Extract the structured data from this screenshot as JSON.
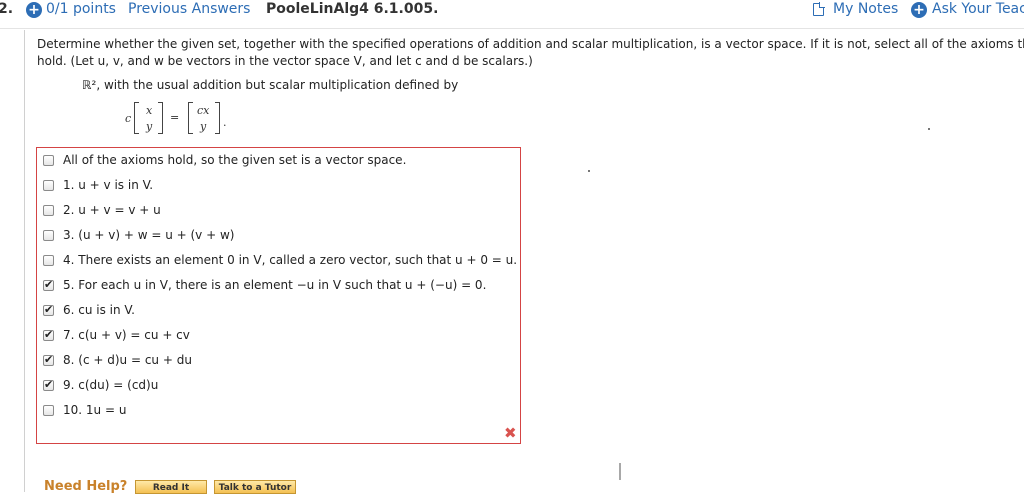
{
  "header": {
    "question_number": "2.",
    "points": "0/1 points",
    "previous_answers": "Previous Answers",
    "identifier": "PooleLinAlg4 6.1.005.",
    "my_notes": "My Notes",
    "ask_teacher": "Ask Your Teac"
  },
  "question": {
    "prompt_line1": "Determine whether the given set, together with the specified operations of addition and scalar multiplication, is a vector space. If it is not, select all of the axioms that fai",
    "prompt_line2": "hold. (Let u, v, and w be vectors in the vector space V, and let c and d be scalars.)",
    "set_description": "ℝ², with the usual addition but scalar multiplication defined by",
    "formula": {
      "scalar": "c",
      "left_top": "x",
      "left_bottom": "y",
      "equals": "=",
      "right_top": "cx",
      "right_bottom": "y",
      "end": "."
    }
  },
  "options": [
    {
      "text": "All of the axioms hold, so the given set is a vector space.",
      "checked": false
    },
    {
      "text": "1. u + v is in V.",
      "checked": false
    },
    {
      "text": "2. u + v = v + u",
      "checked": false
    },
    {
      "text": "3. (u + v) + w = u + (v + w)",
      "checked": false
    },
    {
      "text": "4. There exists an element 0 in V, called a zero vector, such that u + 0 = u.",
      "checked": false
    },
    {
      "text": "5. For each u in V, there is an element −u in V such that u + (−u) = 0.",
      "checked": true
    },
    {
      "text": "6. cu is in V.",
      "checked": true
    },
    {
      "text": "7. c(u + v) = cu + cv",
      "checked": true
    },
    {
      "text": "8. (c + d)u = cu + du",
      "checked": true
    },
    {
      "text": "9. c(du) = (cd)u",
      "checked": true
    },
    {
      "text": "10. 1u = u",
      "checked": false
    }
  ],
  "result_mark": "✖",
  "help": {
    "label": "Need Help?",
    "read_it": "Read It",
    "talk_to_tutor": "Talk to a Tutor"
  },
  "colors": {
    "link": "#2d6db5",
    "error": "#d44444",
    "help": "#c9822b",
    "button": "#f4c052"
  }
}
